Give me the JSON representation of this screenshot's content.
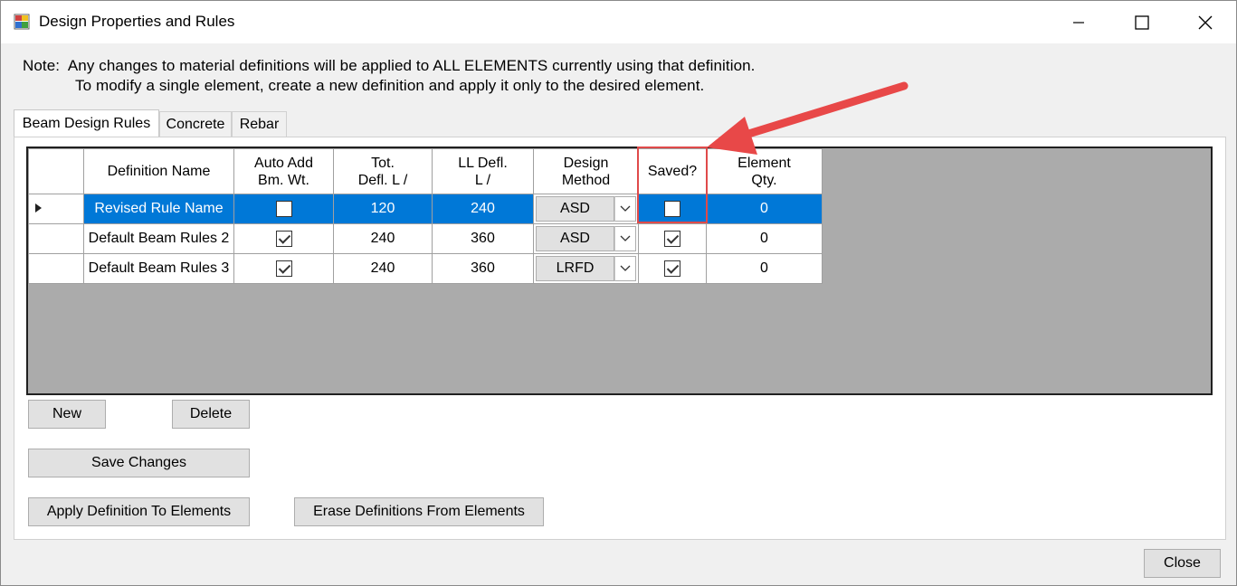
{
  "window": {
    "title": "Design Properties and Rules",
    "controls": [
      "minimize-icon",
      "maximize-icon",
      "close-icon"
    ]
  },
  "note": {
    "line1": "Note:  Any changes to material definitions will be applied to ALL ELEMENTS currently using that definition.",
    "line2": "To modify a single element, create a new definition and apply it only to the desired element."
  },
  "tabs": [
    {
      "label": "Beam Design Rules",
      "active": true
    },
    {
      "label": "Concrete",
      "active": false
    },
    {
      "label": "Rebar",
      "active": false
    }
  ],
  "grid": {
    "columns": {
      "name": "Definition Name",
      "auto_add_1": "Auto Add",
      "auto_add_2": "Bm. Wt.",
      "tot_1": "Tot.",
      "tot_2": "Defl. L /",
      "ll_1": "LL Defl.",
      "ll_2": "L /",
      "method_1": "Design",
      "method_2": "Method",
      "saved": "Saved?",
      "qty_1": "Element",
      "qty_2": "Qty."
    },
    "rows": [
      {
        "name": "Revised Rule Name",
        "auto_add": false,
        "tot_defl": "120",
        "ll_defl": "240",
        "method": "ASD",
        "saved": false,
        "qty": "0",
        "selected": true
      },
      {
        "name": "Default Beam Rules 2",
        "auto_add": true,
        "tot_defl": "240",
        "ll_defl": "360",
        "method": "ASD",
        "saved": true,
        "qty": "0",
        "selected": false
      },
      {
        "name": "Default Beam Rules 3",
        "auto_add": true,
        "tot_defl": "240",
        "ll_defl": "360",
        "method": "LRFD",
        "saved": true,
        "qty": "0",
        "selected": false
      }
    ]
  },
  "buttons": {
    "new": "New",
    "delete": "Delete",
    "save_changes": "Save Changes",
    "apply": "Apply Definition To Elements",
    "erase": "Erase Definitions From Elements",
    "close": "Close"
  },
  "colors": {
    "selection": "#0078d7",
    "annotation": "#e04a4a",
    "grid_background": "#ababab"
  }
}
